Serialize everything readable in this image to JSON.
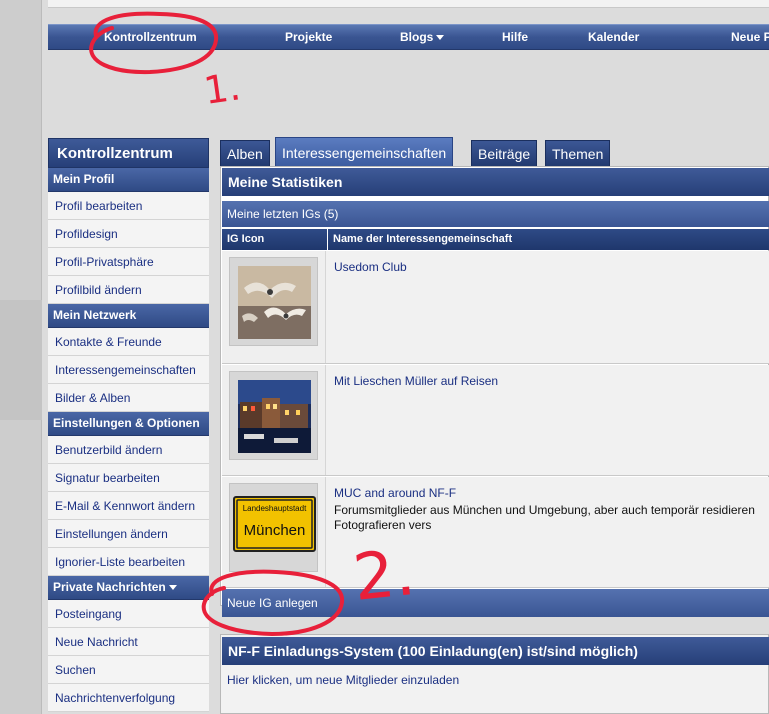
{
  "navbar": {
    "items": [
      "Kontrollzentrum",
      "Projekte",
      "Blogs",
      "Hilfe",
      "Kalender",
      "Neue P"
    ]
  },
  "sidebar": {
    "title": "Kontrollzentrum",
    "sections": [
      {
        "header": "Mein Profil",
        "items": [
          "Profil bearbeiten",
          "Profildesign",
          "Profil-Privatsphäre",
          "Profilbild ändern"
        ]
      },
      {
        "header": "Mein Netzwerk",
        "items": [
          "Kontakte & Freunde",
          "Interessengemeinschaften",
          "Bilder & Alben"
        ]
      },
      {
        "header": "Einstellungen & Optionen",
        "items": [
          "Benutzerbild ändern",
          "Signatur bearbeiten",
          "E-Mail & Kennwort ändern",
          "Einstellungen ändern",
          "Ignorier-Liste bearbeiten"
        ]
      },
      {
        "header": "Private Nachrichten",
        "items": [
          "Posteingang",
          "Neue Nachricht",
          "Suchen",
          "Nachrichtenverfolgung"
        ]
      }
    ]
  },
  "tabs": [
    "Alben",
    "Interessengemeinschaften",
    "Beiträge",
    "Themen"
  ],
  "stats": {
    "title": "Meine Statistiken",
    "subheader": "Meine letzten IGs (5)",
    "columns": [
      "IG Icon",
      "Name der Interessengemeinschaft"
    ],
    "rows": [
      {
        "name": "Usedom Club",
        "description": "",
        "icon": "seagulls-photo"
      },
      {
        "name": "Mit Lieschen Müller auf Reisen",
        "description": "",
        "icon": "night-harbor-photo"
      },
      {
        "name": "MUC and around NF-F",
        "description": "Forumsmitglieder aus München und Umgebung, aber auch temporär residieren",
        "description2": "Fotografieren vers",
        "icon": "city-sign"
      }
    ],
    "city_sign": {
      "top": "Landeshauptstadt",
      "main": "München"
    },
    "new_ig_label": "Neue IG anlegen"
  },
  "invite": {
    "title": "NF-F Einladungs-System (100 Einladung(en) ist/sind möglich)",
    "link": "Hier klicken, um neue Mitglieder einzuladen"
  },
  "annotations": {
    "one": "1.",
    "two": "2."
  },
  "colors": {
    "nav_blue": "#2f4a85",
    "link_blue": "#1a2f82",
    "annotation_red": "#e8203a",
    "sign_yellow": "#f2c200"
  }
}
